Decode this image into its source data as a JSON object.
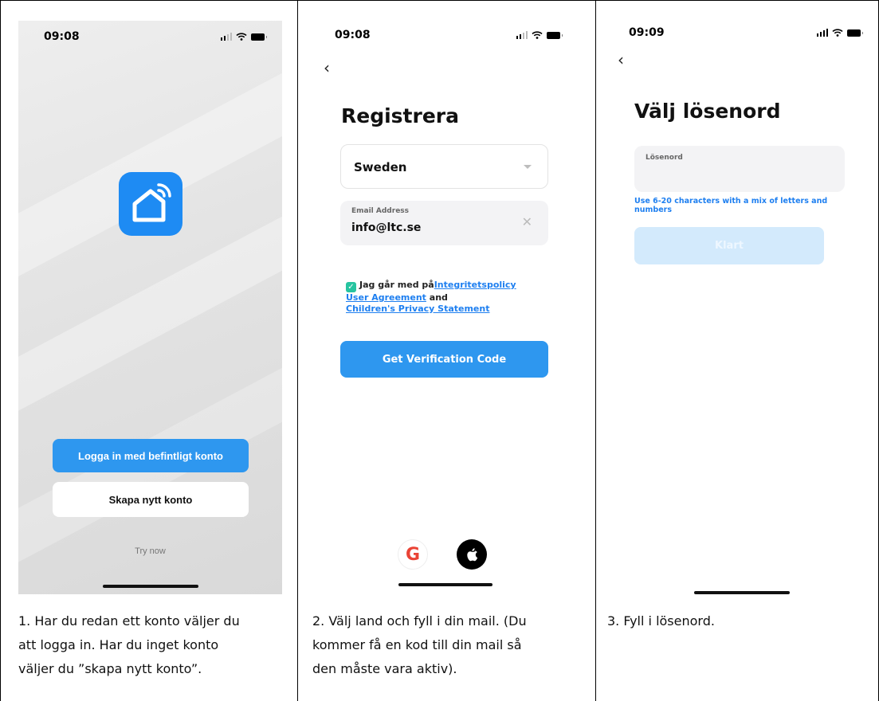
{
  "panel1": {
    "time": "09:08",
    "login_button": "Logga in med befintligt konto",
    "create_button": "Skapa nytt konto",
    "try_now": "Try now",
    "caption": [
      "1. Har du redan ett konto väljer du",
      "att logga in. Har du inget konto",
      "väljer du ”skapa nytt konto”."
    ]
  },
  "panel2": {
    "time": "09:08",
    "back_icon": "chevron-left-icon",
    "title": "Registrera",
    "country": "Sweden",
    "email_label": "Email Address",
    "email_value": "info@ltc.se",
    "agree_text": "Jag går med på",
    "privacy_link": "Integritetspolicy",
    "user_agreement_link": "User Agreement",
    "and_text": "and",
    "children_link": "Children's Privacy Statement",
    "verify_button": "Get Verification Code",
    "caption": [
      "2. Välj land och fyll i din mail. (Du",
      "kommer få en kod till din mail så",
      "den måste vara aktiv)."
    ]
  },
  "panel3": {
    "time": "09:09",
    "back_icon": "chevron-left-icon",
    "title": "Välj lösenord",
    "password_label": "Lösenord",
    "hint": "Use 6-20 characters with a mix of letters and numbers",
    "done_button": "Klart",
    "caption": [
      "3. Fyll i lösenord."
    ]
  },
  "colors": {
    "accent": "#2e97ef",
    "link": "#1e7ff0",
    "checkbox": "#27c4a0",
    "disabled_button": "#d3eafc"
  }
}
